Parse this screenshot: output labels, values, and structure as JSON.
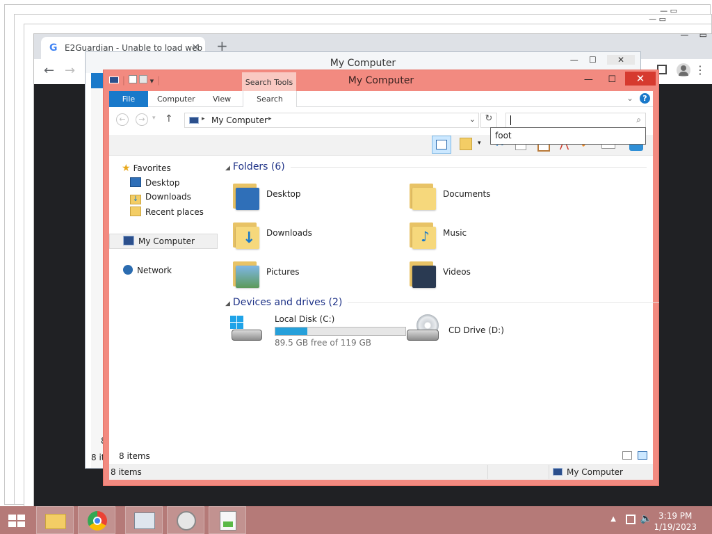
{
  "chrome": {
    "tab_title": "E2Guardian - Unable to load web",
    "tab_close": "×",
    "new_tab": "+",
    "back": "←",
    "forward": "→"
  },
  "back_window": {
    "title": "My Computer",
    "status": "8 it",
    "num": "8"
  },
  "window": {
    "title": "My Computer",
    "context_tab": "Search Tools",
    "min": "—",
    "max": "☐",
    "close": "✕"
  },
  "ribbon": {
    "tabs": [
      "File",
      "Computer",
      "View",
      "Search"
    ]
  },
  "address": {
    "path": "My Computer",
    "search_value": "",
    "suggestion": "foot"
  },
  "nav": {
    "favorites": "Favorites",
    "items": [
      "Desktop",
      "Downloads",
      "Recent places"
    ],
    "my_computer": "My Computer",
    "network": "Network"
  },
  "folders": {
    "header": "Folders (6)",
    "items": [
      "Desktop",
      "Documents",
      "Downloads",
      "Music",
      "Pictures",
      "Videos"
    ]
  },
  "devices": {
    "header": "Devices and drives (2)",
    "local_disk": {
      "name": "Local Disk (C:)",
      "free": "89.5 GB free of 119 GB",
      "used_fraction": 0.248
    },
    "cd_drive": {
      "name": "CD Drive (D:)"
    }
  },
  "footer": {
    "count": "8 items"
  },
  "status": {
    "count": "8 items",
    "location": "My Computer"
  },
  "taskbar": {
    "time": "3:19 PM",
    "date": "1/19/2023"
  },
  "colors": {
    "accent": "#1979ca",
    "window_frame": "#f28a80",
    "close": "#d63a2f",
    "progress": "#26a0da",
    "taskbar": "#b57a78"
  }
}
